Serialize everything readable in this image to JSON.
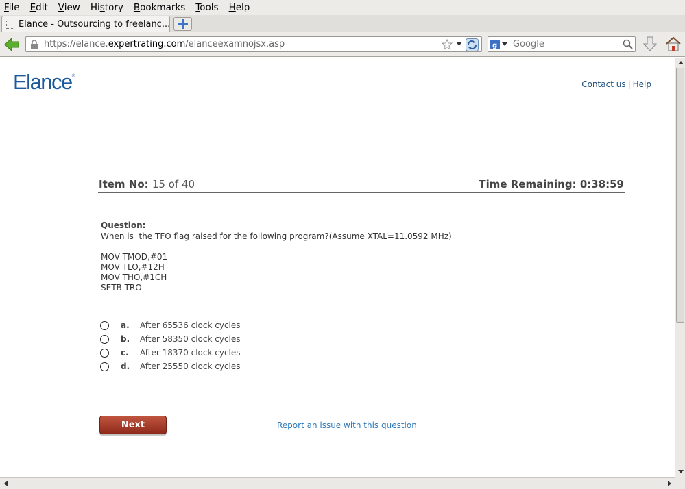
{
  "browser": {
    "menu": [
      "File",
      "Edit",
      "View",
      "History",
      "Bookmarks",
      "Tools",
      "Help"
    ],
    "menu_underline": [
      "F",
      "E",
      "V",
      "s",
      "B",
      "T",
      "H"
    ],
    "tab_title": "Elance - Outsourcing to freelanc...",
    "url_prefix": "https://elance.",
    "url_domain": "expertrating.com",
    "url_suffix": "/elanceexamnojsx.asp",
    "search_placeholder": "Google"
  },
  "page": {
    "logo": "Elance",
    "logo_mark": "®",
    "contact_link": "Contact us",
    "separator": "|",
    "help_link": "Help",
    "item_label": "Item No:",
    "item_value": "15 of 40",
    "time_label": "Time Remaining: 0:38:59",
    "question_label": "Question:",
    "question_text": "When is  the TFO flag raised for the following program?(Assume XTAL=11.0592 MHz)",
    "code_lines": [
      "MOV TMOD,#01",
      "MOV TLO,#12H",
      "MOV THO,#1CH",
      "SETB TRO"
    ],
    "options": [
      {
        "letter": "a.",
        "text": "After 65536 clock cycles"
      },
      {
        "letter": "b.",
        "text": "After 58350 clock cycles"
      },
      {
        "letter": "c.",
        "text": "After 18370 clock cycles"
      },
      {
        "letter": "d.",
        "text": "After 25550 clock cycles"
      }
    ],
    "next_label": "Next",
    "report_link": "Report an issue with this question"
  },
  "colors": {
    "logo": "#1b5a9b",
    "link": "#2f7ab9",
    "next_button": "#a33a28"
  }
}
